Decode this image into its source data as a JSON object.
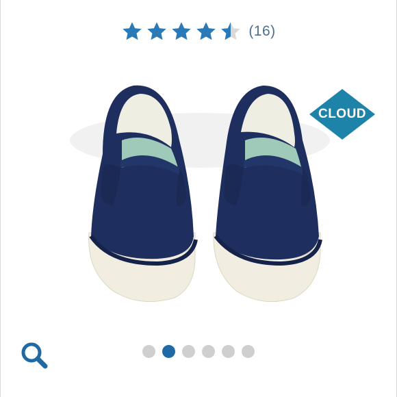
{
  "rating": {
    "value": 4.5,
    "max": 5,
    "count_label": "(16)",
    "star_color": "#2a7ab8",
    "empty_star_color": "#d9d9d9"
  },
  "badge": {
    "label": "CLOUD",
    "color": "#1d83a9"
  },
  "product_image": {
    "description_icon": "navy-slip-on-sneakers-icon",
    "canvas_color": "#1f3262"
  },
  "gallery": {
    "count": 6,
    "active_index": 1,
    "active_color": "#1f6aa5",
    "inactive_color": "#cfcfcf"
  },
  "zoom": {
    "icon": "magnifier-icon",
    "color": "#1f6aa5"
  }
}
